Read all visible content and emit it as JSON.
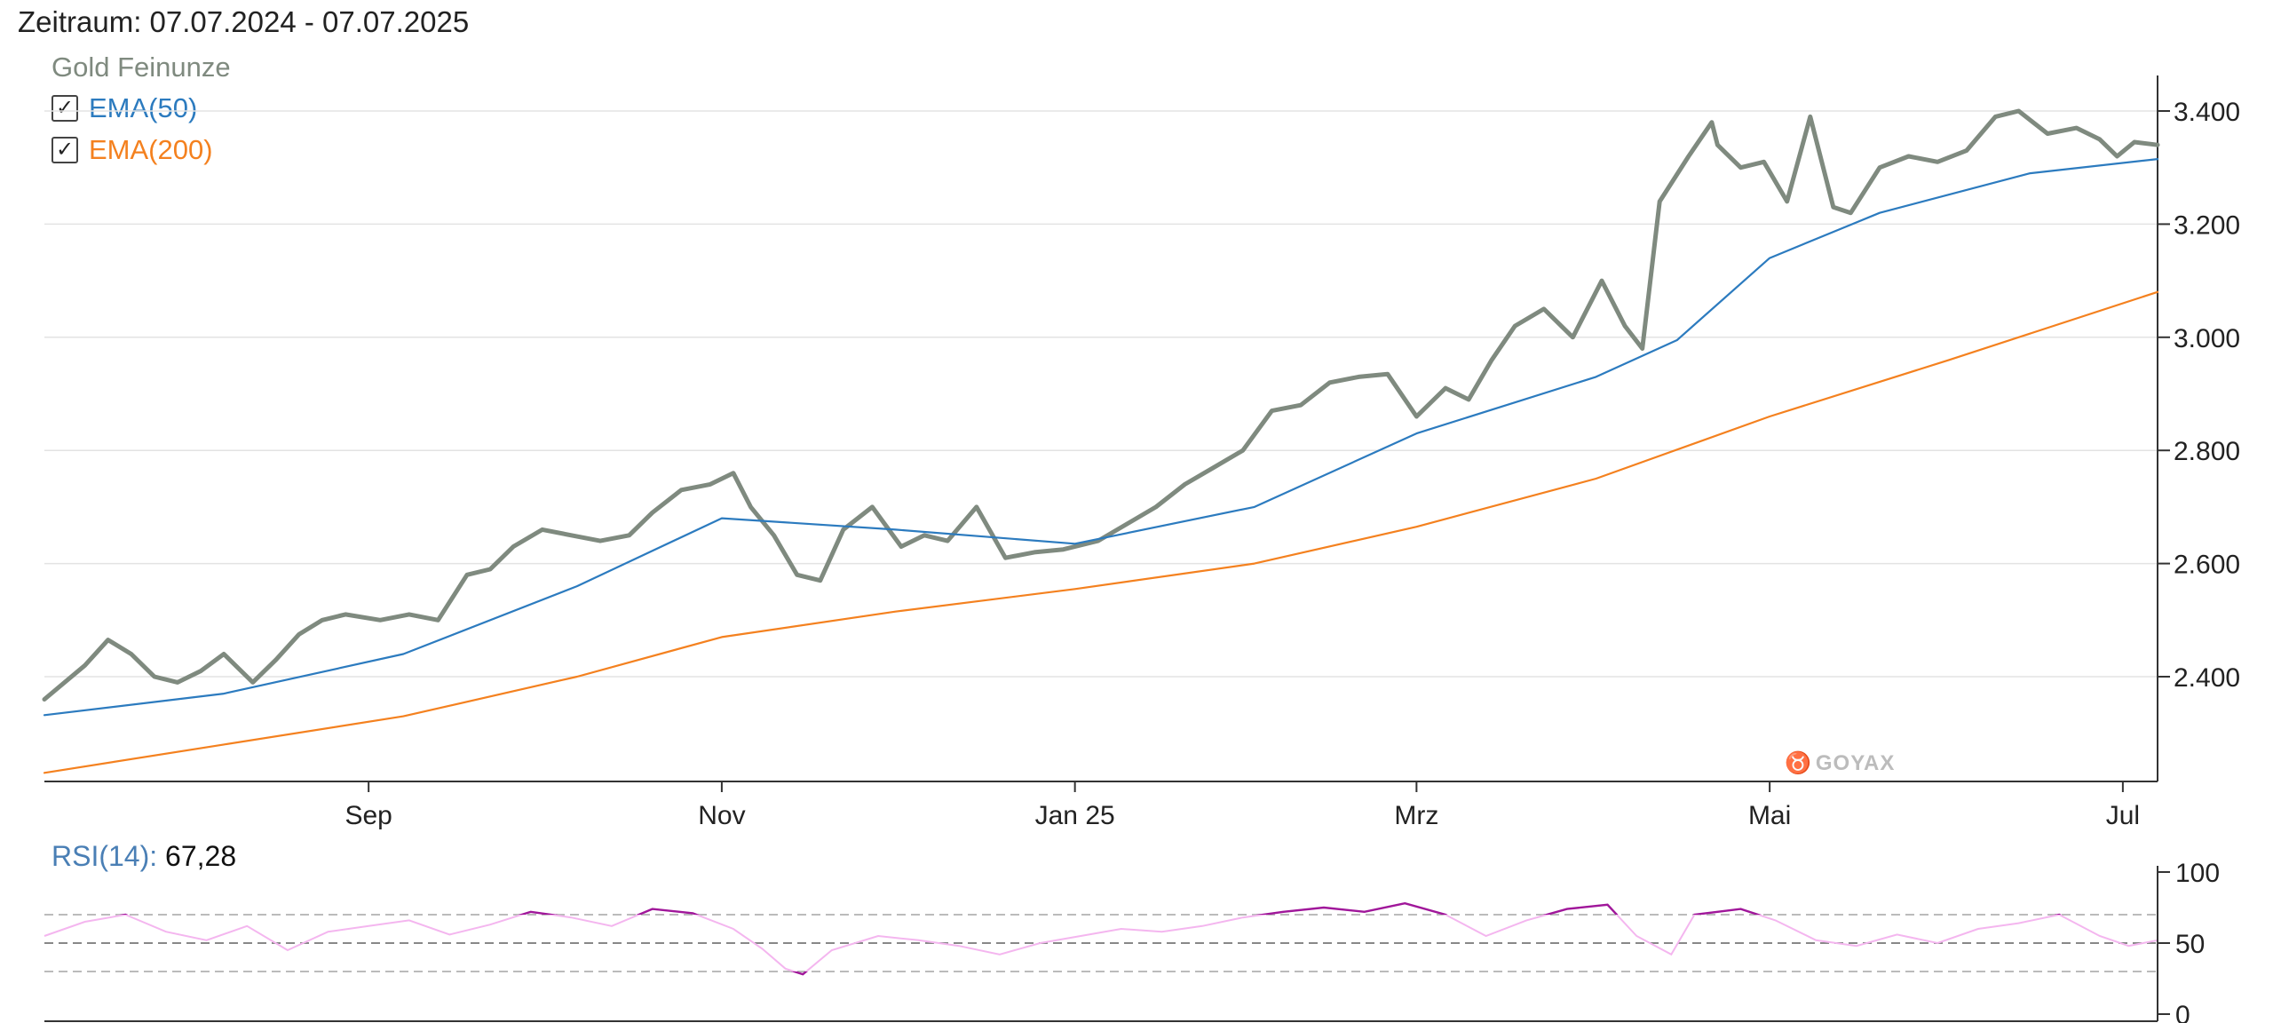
{
  "period_label": "Zeitraum: 07.07.2024 - 07.07.2025",
  "series_title": "Gold Feinunze",
  "legend": [
    {
      "label": "EMA(50)",
      "color": "#2c7bbf",
      "checked": true
    },
    {
      "label": "EMA(200)",
      "color": "#f4811f",
      "checked": true
    }
  ],
  "watermark": "GOYAX",
  "rsi": {
    "label": "RSI(14):",
    "value": "67,28"
  },
  "colors": {
    "price": "#7f8a7f",
    "ema50": "#2c7bbf",
    "ema200": "#f4811f",
    "rsi_light": "#f4b6ef",
    "rsi_dark": "#a0179a"
  },
  "chart_data": [
    {
      "type": "line",
      "title": "Gold Feinunze",
      "x_range": [
        "2024-07-07",
        "2025-07-07"
      ],
      "x_ticks": [
        {
          "label": "Sep",
          "date": "2024-09-01"
        },
        {
          "label": "Nov",
          "date": "2024-11-01"
        },
        {
          "label": "Jan 25",
          "date": "2025-01-01"
        },
        {
          "label": "Mrz",
          "date": "2025-03-01"
        },
        {
          "label": "Mai",
          "date": "2025-05-01"
        },
        {
          "label": "Jul",
          "date": "2025-07-01"
        }
      ],
      "y_ticks": [
        {
          "label": "2.400",
          "value": 2400
        },
        {
          "label": "2.600",
          "value": 2600
        },
        {
          "label": "2.800",
          "value": 2800
        },
        {
          "label": "3.000",
          "value": 3000
        },
        {
          "label": "3.200",
          "value": 3200
        },
        {
          "label": "3.400",
          "value": 3400
        }
      ],
      "ylim": [
        2215,
        3465
      ],
      "grid": "horizontal",
      "legend_position": "top-left",
      "series": [
        {
          "name": "Gold Feinunze",
          "x": [
            "2024-07-07",
            "2024-07-14",
            "2024-07-18",
            "2024-07-22",
            "2024-07-26",
            "2024-07-30",
            "2024-08-03",
            "2024-08-07",
            "2024-08-12",
            "2024-08-16",
            "2024-08-20",
            "2024-08-24",
            "2024-08-28",
            "2024-09-03",
            "2024-09-08",
            "2024-09-13",
            "2024-09-18",
            "2024-09-22",
            "2024-09-26",
            "2024-10-01",
            "2024-10-06",
            "2024-10-11",
            "2024-10-16",
            "2024-10-20",
            "2024-10-25",
            "2024-10-30",
            "2024-11-03",
            "2024-11-06",
            "2024-11-10",
            "2024-11-14",
            "2024-11-18",
            "2024-11-22",
            "2024-11-27",
            "2024-12-02",
            "2024-12-06",
            "2024-12-10",
            "2024-12-15",
            "2024-12-20",
            "2024-12-25",
            "2024-12-30",
            "2025-01-05",
            "2025-01-10",
            "2025-01-15",
            "2025-01-20",
            "2025-01-25",
            "2025-01-30",
            "2025-02-04",
            "2025-02-09",
            "2025-02-14",
            "2025-02-19",
            "2025-02-24",
            "2025-03-01",
            "2025-03-06",
            "2025-03-10",
            "2025-03-14",
            "2025-03-18",
            "2025-03-23",
            "2025-03-28",
            "2025-04-02",
            "2025-04-06",
            "2025-04-09",
            "2025-04-12",
            "2025-04-17",
            "2025-04-21",
            "2025-04-22",
            "2025-04-26",
            "2025-04-30",
            "2025-05-04",
            "2025-05-08",
            "2025-05-12",
            "2025-05-15",
            "2025-05-20",
            "2025-05-25",
            "2025-05-30",
            "2025-06-04",
            "2025-06-09",
            "2025-06-13",
            "2025-06-18",
            "2025-06-23",
            "2025-06-27",
            "2025-06-30",
            "2025-07-03",
            "2025-07-07"
          ],
          "y": [
            2360,
            2420,
            2465,
            2440,
            2400,
            2390,
            2410,
            2440,
            2390,
            2430,
            2475,
            2500,
            2510,
            2500,
            2510,
            2500,
            2580,
            2590,
            2630,
            2660,
            2650,
            2640,
            2650,
            2690,
            2730,
            2740,
            2760,
            2700,
            2650,
            2580,
            2570,
            2660,
            2700,
            2630,
            2650,
            2640,
            2700,
            2610,
            2620,
            2625,
            2640,
            2670,
            2700,
            2740,
            2770,
            2800,
            2870,
            2880,
            2920,
            2930,
            2935,
            2860,
            2910,
            2890,
            2960,
            3020,
            3050,
            3000,
            3100,
            3020,
            2980,
            3240,
            3320,
            3380,
            3340,
            3300,
            3310,
            3240,
            3390,
            3230,
            3220,
            3300,
            3320,
            3310,
            3330,
            3390,
            3400,
            3360,
            3370,
            3350,
            3320,
            3345,
            3340
          ]
        },
        {
          "name": "EMA(50)",
          "x": [
            "2024-07-07",
            "2024-08-07",
            "2024-09-07",
            "2024-10-07",
            "2024-11-01",
            "2024-12-01",
            "2025-01-01",
            "2025-02-01",
            "2025-03-01",
            "2025-04-01",
            "2025-04-15",
            "2025-05-01",
            "2025-05-20",
            "2025-06-15",
            "2025-07-07"
          ],
          "y": [
            2332,
            2370,
            2440,
            2560,
            2680,
            2660,
            2635,
            2700,
            2830,
            2930,
            2995,
            3140,
            3220,
            3290,
            3315
          ]
        },
        {
          "name": "EMA(200)",
          "x": [
            "2024-07-07",
            "2024-08-07",
            "2024-09-07",
            "2024-10-07",
            "2024-11-01",
            "2024-12-01",
            "2025-01-01",
            "2025-02-01",
            "2025-03-01",
            "2025-04-01",
            "2025-05-01",
            "2025-06-01",
            "2025-07-07"
          ],
          "y": [
            2230,
            2280,
            2330,
            2400,
            2470,
            2515,
            2555,
            2600,
            2665,
            2750,
            2860,
            2960,
            3080
          ]
        }
      ]
    },
    {
      "type": "line",
      "title": "RSI(14)",
      "x_range": [
        "2024-07-07",
        "2025-07-07"
      ],
      "ylim": [
        0,
        100
      ],
      "y_ticks": [
        {
          "label": "100",
          "value": 100
        },
        {
          "label": "50",
          "value": 50
        },
        {
          "label": "0",
          "value": 0
        }
      ],
      "reference_lines": [
        70,
        50,
        30
      ],
      "overbought": 70,
      "oversold": 30,
      "series": [
        {
          "name": "RSI(14)",
          "x": [
            "2024-07-07",
            "2024-07-14",
            "2024-07-21",
            "2024-07-28",
            "2024-08-04",
            "2024-08-11",
            "2024-08-18",
            "2024-08-25",
            "2024-09-01",
            "2024-09-08",
            "2024-09-15",
            "2024-09-22",
            "2024-09-29",
            "2024-10-06",
            "2024-10-13",
            "2024-10-20",
            "2024-10-27",
            "2024-11-03",
            "2024-11-08",
            "2024-11-12",
            "2024-11-15",
            "2024-11-20",
            "2024-11-28",
            "2024-12-05",
            "2024-12-12",
            "2024-12-19",
            "2024-12-26",
            "2025-01-02",
            "2025-01-09",
            "2025-01-16",
            "2025-01-23",
            "2025-01-30",
            "2025-02-06",
            "2025-02-13",
            "2025-02-20",
            "2025-02-27",
            "2025-03-06",
            "2025-03-13",
            "2025-03-20",
            "2025-03-27",
            "2025-04-03",
            "2025-04-08",
            "2025-04-14",
            "2025-04-18",
            "2025-04-22",
            "2025-04-26",
            "2025-05-02",
            "2025-05-09",
            "2025-05-16",
            "2025-05-23",
            "2025-05-30",
            "2025-06-06",
            "2025-06-13",
            "2025-06-20",
            "2025-06-27",
            "2025-07-02",
            "2025-07-07"
          ],
          "y": [
            55,
            65,
            70,
            58,
            52,
            62,
            45,
            58,
            62,
            66,
            56,
            63,
            72,
            68,
            62,
            74,
            71,
            60,
            46,
            32,
            28,
            45,
            55,
            52,
            48,
            42,
            50,
            55,
            60,
            58,
            62,
            68,
            72,
            75,
            72,
            78,
            70,
            55,
            66,
            74,
            77,
            55,
            42,
            70,
            72,
            74,
            66,
            52,
            48,
            56,
            50,
            60,
            64,
            70,
            55,
            48,
            52
          ]
        }
      ]
    }
  ]
}
